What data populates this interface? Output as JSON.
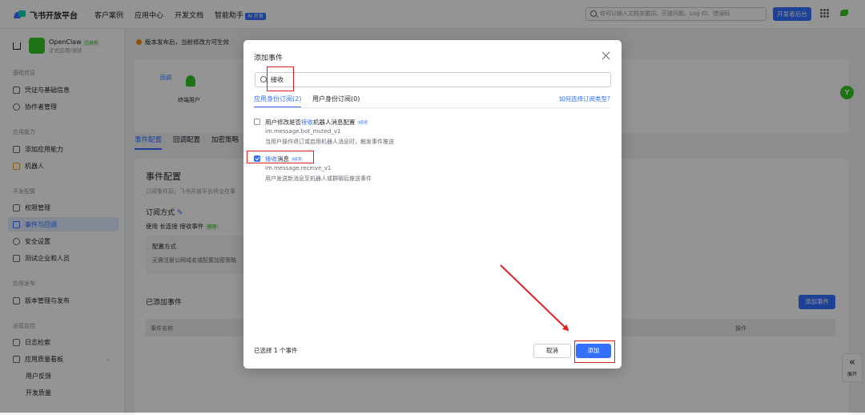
{
  "topbar": {
    "brand": "飞书开放平台",
    "nav": [
      "客户案例",
      "应用中心",
      "开发文档",
      "智能助手"
    ],
    "ai_badge": "AI 开发",
    "search_placeholder": "你可以输入文档关键词、开放问题、Log ID、错误码",
    "dev_console": "开发者后台"
  },
  "sidebar": {
    "app_name": "OpenClaw",
    "app_tag": "已启用",
    "app_sub": "正式应用/测试",
    "sections": [
      {
        "title": "基础信息",
        "items": [
          "凭证与基础信息",
          "协作者管理"
        ]
      },
      {
        "title": "应用能力",
        "items": [
          "添加应用能力",
          "机器人"
        ]
      },
      {
        "title": "开发配置",
        "items": [
          "权限管理",
          "事件与回调",
          "安全设置",
          "测试企业和人员"
        ]
      },
      {
        "title": "应用发布",
        "items": [
          "版本管理与发布"
        ]
      },
      {
        "title": "运营监控",
        "items": [
          "日志检索",
          "应用质量看板",
          "用户反馈",
          "开发质量"
        ]
      }
    ]
  },
  "main": {
    "notice": "版本发布后，当前修改方可生效",
    "flow_labels": [
      "回调",
      "终端用户"
    ],
    "tabs": [
      "事件配置",
      "回调配置",
      "加密策略"
    ],
    "section_title": "事件配置",
    "section_desc": "订阅事件后，飞书开放平台将会在事",
    "subscribe_mode_label": "订阅方式",
    "subscribe_mode_value": "使用 长连接 接收事件",
    "subscribe_badge": "推荐",
    "config_box_title": "配置方式",
    "config_box_desc": "无需注册公网域名或配置加密策略",
    "added_events": "已添加事件",
    "add_event_btn": "添加事件",
    "table_cols": [
      "事件名称",
      "操作"
    ]
  },
  "modal": {
    "title": "添加事件",
    "search_value": "接收",
    "tabs": [
      "应用身份订阅(2)",
      "用户身份订阅(0)"
    ],
    "help_link": "如何选择订阅类型?",
    "events": [
      {
        "name_before": "用户修改是否",
        "name_kw": "接收",
        "name_after": "机器人消息配置",
        "version": "v2.0",
        "code": "im.message.bot_muted_v1",
        "desc": "当用户操作退订或启用机器人消息时，触发事件推送",
        "checked": false
      },
      {
        "name_before": "",
        "name_kw": "接收",
        "name_after": "消息",
        "version": "v2.0",
        "code": "im.message.receive_v1",
        "desc": "用户发送新消息至机器人或群聊后推送事件",
        "checked": true
      }
    ],
    "selected_count_text": "已选择 1 个事件",
    "cancel": "取消",
    "add": "添加"
  },
  "floating": {
    "expand_label": "展开",
    "expand_icon": "«",
    "assistant": "Y"
  },
  "colors": {
    "primary": "#3370ff",
    "annotation": "#e02020",
    "brand_green": "#34c724"
  }
}
